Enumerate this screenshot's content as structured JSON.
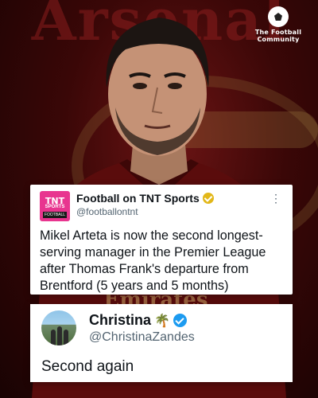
{
  "background": {
    "word": "Arsenal"
  },
  "brand": {
    "name_line1": "The Football",
    "name_line2": "Community",
    "icon": "soccer-ball-icon"
  },
  "colors": {
    "tnt_pink": "#e8358f",
    "verified_gold": "#e2b719",
    "verified_blue": "#1d9bf0",
    "arsenal_red": "#6b1414"
  },
  "tweet_main": {
    "avatar_text_top": "TNT",
    "avatar_text_mid": "SPORTS",
    "avatar_text_bottom": "FOOTBALL",
    "display_name": "Football on TNT Sports",
    "handle": "@footballontnt",
    "verified_icon": "gold-verified-badge-icon",
    "more_icon": "more-options-icon",
    "text": "Mikel Arteta is now the second longest-serving manager in the Premier League after Thomas Frank's departure from Brentford (5 years and 5 months)"
  },
  "tweet_reply": {
    "display_name": "Christina",
    "emoji": "🌴",
    "handle": "@ChristinaZandes",
    "verified_icon": "blue-verified-badge-icon",
    "text": "Second again"
  }
}
